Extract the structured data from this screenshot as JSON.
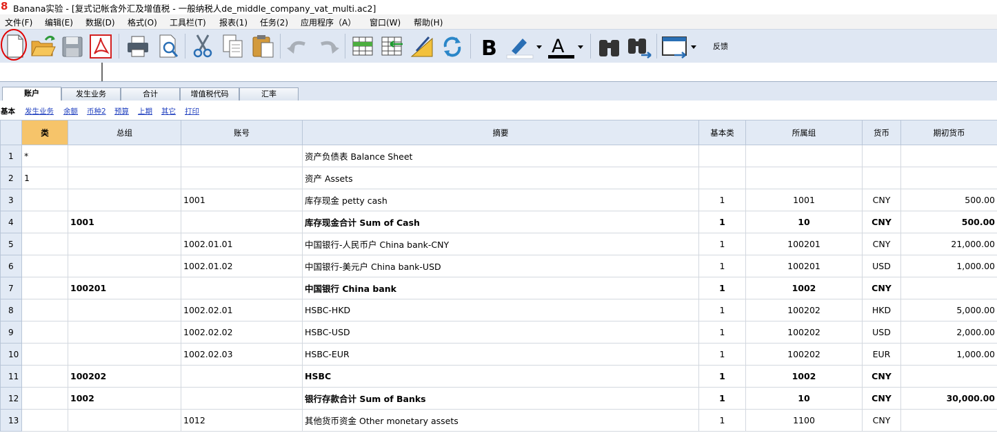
{
  "window": {
    "title": "Banana实验 - [复式记帐含外汇及增值税 - 一般纳税人de_middle_company_vat_multi.ac2]"
  },
  "menu": [
    "文件(F)",
    "编辑(E)",
    "数据(D)",
    "格式(O)",
    "工具栏(T)",
    "报表(1)",
    "任务(2)",
    "应用程序（A）",
    "窗口(W)",
    "帮助(H)"
  ],
  "toolbar": {
    "feedback_label": "反馈"
  },
  "tabs": [
    "账户",
    "发生业务",
    "合计",
    "增值税代码",
    "汇率"
  ],
  "views": [
    "基本",
    "发生业务",
    "余额",
    "币种2",
    "预算",
    "上期",
    "其它",
    "打印"
  ],
  "table": {
    "columns": [
      "类",
      "总组",
      "账号",
      "摘要",
      "基本类",
      "所属组",
      "货币",
      "期初货币"
    ],
    "rows": [
      {
        "n": "1",
        "cls": "*",
        "group": "",
        "account": "",
        "desc": "资产负债表 Balance Sheet",
        "bclass": "",
        "gr": "",
        "cur": "",
        "open": ""
      },
      {
        "n": "2",
        "cls": "1",
        "group": "",
        "account": "",
        "desc": "资产 Assets",
        "bclass": "",
        "gr": "",
        "cur": "",
        "open": ""
      },
      {
        "n": "3",
        "cls": "",
        "group": "",
        "account": "1001",
        "desc": "库存现金 petty cash",
        "bclass": "1",
        "gr": "1001",
        "cur": "CNY",
        "open": "500.00"
      },
      {
        "n": "4",
        "cls": "",
        "group": "1001",
        "account": "",
        "desc": "库存现金合计 Sum of Cash",
        "bclass": "1",
        "gr": "10",
        "cur": "CNY",
        "open": "500.00",
        "bold": true
      },
      {
        "n": "5",
        "cls": "",
        "group": "",
        "account": "1002.01.01",
        "desc": "中国银行-人民币户 China bank-CNY",
        "bclass": "1",
        "gr": "100201",
        "cur": "CNY",
        "open": "21,000.00"
      },
      {
        "n": "6",
        "cls": "",
        "group": "",
        "account": "1002.01.02",
        "desc": "中国银行-美元户 China bank-USD",
        "bclass": "1",
        "gr": "100201",
        "cur": "USD",
        "open": "1,000.00"
      },
      {
        "n": "7",
        "cls": "",
        "group": "100201",
        "account": "",
        "desc": "中国银行 China bank",
        "bclass": "1",
        "gr": "1002",
        "cur": "CNY",
        "open": "",
        "bold": true
      },
      {
        "n": "8",
        "cls": "",
        "group": "",
        "account": "1002.02.01",
        "desc": "HSBC-HKD",
        "bclass": "1",
        "gr": "100202",
        "cur": "HKD",
        "open": "5,000.00"
      },
      {
        "n": "9",
        "cls": "",
        "group": "",
        "account": "1002.02.02",
        "desc": "HSBC-USD",
        "bclass": "1",
        "gr": "100202",
        "cur": "USD",
        "open": "2,000.00"
      },
      {
        "n": "10",
        "cls": "",
        "group": "",
        "account": "1002.02.03",
        "desc": "HSBC-EUR",
        "bclass": "1",
        "gr": "100202",
        "cur": "EUR",
        "open": "1,000.00"
      },
      {
        "n": "11",
        "cls": "",
        "group": "100202",
        "account": "",
        "desc": "HSBC",
        "bclass": "1",
        "gr": "1002",
        "cur": "CNY",
        "open": "",
        "bold": true
      },
      {
        "n": "12",
        "cls": "",
        "group": "1002",
        "account": "",
        "desc": "银行存款合计 Sum of Banks",
        "bclass": "1",
        "gr": "10",
        "cur": "CNY",
        "open": "30,000.00",
        "bold": true
      },
      {
        "n": "13",
        "cls": "",
        "group": "",
        "account": "1012",
        "desc": "其他货币资金 Other monetary assets",
        "bclass": "1",
        "gr": "1100",
        "cur": "CNY",
        "open": ""
      }
    ]
  },
  "colors": {
    "toolbar_bg": "#dfe7f3",
    "header_bg": "#e2eaf5",
    "sorted_header": "#f6c46a",
    "link": "#1f3fbf",
    "highlight_ring": "#e00000"
  }
}
